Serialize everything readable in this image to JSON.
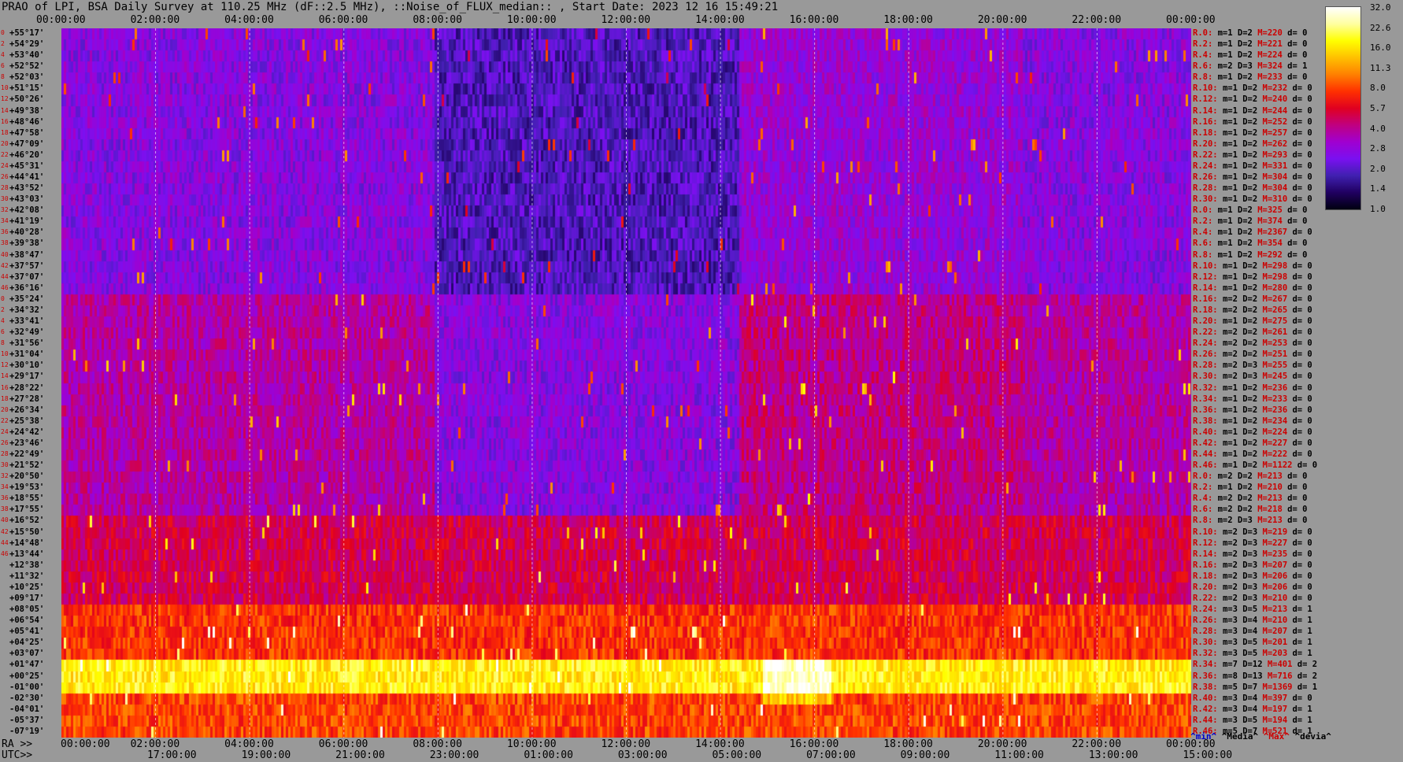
{
  "title": "PRAO of LPI, BSA Daily Survey at 110.25 MHz (dF::2.5 MHz), ::Noise_of_FLUX_median:: , Start Date: 2023 12 16 15:49:21",
  "chart_data": {
    "type": "heatmap",
    "title": "PRAO of LPI, BSA Daily Survey at 110.25 MHz (dF::2.5 MHz), ::Noise_of_FLUX_median:: , Start Date: 2023 12 16 15:49:21",
    "top_ticks": [
      "00:00:00",
      "02:00:00",
      "04:00:00",
      "06:00:00",
      "08:00:00",
      "10:00:00",
      "12:00:00",
      "14:00:00",
      "16:00:00",
      "18:00:00",
      "20:00:00",
      "22:00:00",
      "00:00:00"
    ],
    "ra_prefix": "RA >>",
    "ra_ticks": [
      "00:00:00",
      "02:00:00",
      "04:00:00",
      "06:00:00",
      "08:00:00",
      "10:00:00",
      "12:00:00",
      "14:00:00",
      "16:00:00",
      "18:00:00",
      "20:00:00",
      "22:00:00",
      "00:00:00"
    ],
    "utc_prefix": "UTC>>",
    "utc_ticks": [
      "17:00:00",
      "19:00:00",
      "21:00:00",
      "23:00:00",
      "01:00:00",
      "03:00:00",
      "05:00:00",
      "07:00:00",
      "09:00:00",
      "11:00:00",
      "13:00:00",
      "15:00:00"
    ],
    "row_indices": [
      "0",
      "2",
      "4",
      "6",
      "8",
      "10",
      "12",
      "14",
      "16",
      "18",
      "20",
      "22",
      "24",
      "26",
      "28",
      "30",
      "32",
      "34",
      "36",
      "38",
      "40",
      "42",
      "44",
      "46",
      "0",
      "2",
      "4",
      "6",
      "8",
      "10",
      "12",
      "14",
      "16",
      "18",
      "20",
      "22",
      "24",
      "26",
      "28",
      "30",
      "32",
      "34",
      "36",
      "38",
      "40",
      "42",
      "44",
      "46"
    ],
    "declinations": [
      "+55°17'",
      "+54°29'",
      "+53°40'",
      "+52°52'",
      "+52°03'",
      "+51°15'",
      "+50°26'",
      "+49°38'",
      "+48°46'",
      "+47°58'",
      "+47°09'",
      "+46°20'",
      "+45°31'",
      "+44°41'",
      "+43°52'",
      "+43°03'",
      "+42°08'",
      "+41°19'",
      "+40°28'",
      "+39°38'",
      "+38°47'",
      "+37°57'",
      "+37°07'",
      "+36°16'",
      "+35°24'",
      "+34°32'",
      "+33°41'",
      "+32°49'",
      "+31°56'",
      "+31°04'",
      "+30°10'",
      "+29°17'",
      "+28°22'",
      "+27°28'",
      "+26°34'",
      "+25°38'",
      "+24°42'",
      "+23°46'",
      "+22°49'",
      "+21°52'",
      "+20°50'",
      "+19°53'",
      "+18°55'",
      "+17°55'",
      "+16°52'",
      "+15°50'",
      "+14°48'",
      "+13°44'",
      "+12°38'",
      "+11°32'",
      "+10°25'",
      "+09°17'",
      "+08°05'",
      "+06°54'",
      "+05°41'",
      "+04°25'",
      "+03°07'",
      "+01°47'",
      "+00°25'",
      "-01°00'",
      "-02°30'",
      "-04°01'",
      "-05°37'",
      "-07°19'"
    ],
    "stats": [
      {
        "r": "R.0:",
        "m": "1",
        "D": "2",
        "M": "220",
        "d": "0"
      },
      {
        "r": "R.2:",
        "m": "1",
        "D": "2",
        "M": "221",
        "d": "0"
      },
      {
        "r": "R.4:",
        "m": "1",
        "D": "2",
        "M": "224",
        "d": "0"
      },
      {
        "r": "R.6:",
        "m": "2",
        "D": "3",
        "M": "324",
        "d": "1"
      },
      {
        "r": "R.8:",
        "m": "1",
        "D": "2",
        "M": "233",
        "d": "0"
      },
      {
        "r": "R.10:",
        "m": "1",
        "D": "2",
        "M": "232",
        "d": "0"
      },
      {
        "r": "R.12:",
        "m": "1",
        "D": "2",
        "M": "240",
        "d": "0"
      },
      {
        "r": "R.14:",
        "m": "1",
        "D": "2",
        "M": "244",
        "d": "0"
      },
      {
        "r": "R.16:",
        "m": "1",
        "D": "2",
        "M": "252",
        "d": "0"
      },
      {
        "r": "R.18:",
        "m": "1",
        "D": "2",
        "M": "257",
        "d": "0"
      },
      {
        "r": "R.20:",
        "m": "1",
        "D": "2",
        "M": "262",
        "d": "0"
      },
      {
        "r": "R.22:",
        "m": "1",
        "D": "2",
        "M": "293",
        "d": "0"
      },
      {
        "r": "R.24:",
        "m": "1",
        "D": "2",
        "M": "331",
        "d": "0"
      },
      {
        "r": "R.26:",
        "m": "1",
        "D": "2",
        "M": "304",
        "d": "0"
      },
      {
        "r": "R.28:",
        "m": "1",
        "D": "2",
        "M": "304",
        "d": "0"
      },
      {
        "r": "R.30:",
        "m": "1",
        "D": "2",
        "M": "310",
        "d": "0"
      },
      {
        "r": "R.0:",
        "m": "1",
        "D": "2",
        "M": "325",
        "d": "0"
      },
      {
        "r": "R.2:",
        "m": "1",
        "D": "2",
        "M": "374",
        "d": "0"
      },
      {
        "r": "R.4:",
        "m": "1",
        "D": "2",
        "M": "2367",
        "d": "0"
      },
      {
        "r": "R.6:",
        "m": "1",
        "D": "2",
        "M": "354",
        "d": "0"
      },
      {
        "r": "R.8:",
        "m": "1",
        "D": "2",
        "M": "292",
        "d": "0"
      },
      {
        "r": "R.10:",
        "m": "1",
        "D": "2",
        "M": "298",
        "d": "0"
      },
      {
        "r": "R.12:",
        "m": "1",
        "D": "2",
        "M": "298",
        "d": "0"
      },
      {
        "r": "R.14:",
        "m": "1",
        "D": "2",
        "M": "280",
        "d": "0"
      },
      {
        "r": "R.16:",
        "m": "2",
        "D": "2",
        "M": "267",
        "d": "0"
      },
      {
        "r": "R.18:",
        "m": "2",
        "D": "2",
        "M": "265",
        "d": "0"
      },
      {
        "r": "R.20:",
        "m": "1",
        "D": "2",
        "M": "275",
        "d": "0"
      },
      {
        "r": "R.22:",
        "m": "2",
        "D": "2",
        "M": "261",
        "d": "0"
      },
      {
        "r": "R.24:",
        "m": "2",
        "D": "2",
        "M": "253",
        "d": "0"
      },
      {
        "r": "R.26:",
        "m": "2",
        "D": "2",
        "M": "251",
        "d": "0"
      },
      {
        "r": "R.28:",
        "m": "2",
        "D": "3",
        "M": "255",
        "d": "0"
      },
      {
        "r": "R.30:",
        "m": "2",
        "D": "3",
        "M": "245",
        "d": "0"
      },
      {
        "r": "R.32:",
        "m": "1",
        "D": "2",
        "M": "236",
        "d": "0"
      },
      {
        "r": "R.34:",
        "m": "1",
        "D": "2",
        "M": "233",
        "d": "0"
      },
      {
        "r": "R.36:",
        "m": "1",
        "D": "2",
        "M": "236",
        "d": "0"
      },
      {
        "r": "R.38:",
        "m": "1",
        "D": "2",
        "M": "234",
        "d": "0"
      },
      {
        "r": "R.40:",
        "m": "1",
        "D": "2",
        "M": "224",
        "d": "0"
      },
      {
        "r": "R.42:",
        "m": "1",
        "D": "2",
        "M": "227",
        "d": "0"
      },
      {
        "r": "R.44:",
        "m": "1",
        "D": "2",
        "M": "222",
        "d": "0"
      },
      {
        "r": "R.46:",
        "m": "1",
        "D": "2",
        "M": "1122",
        "d": "0"
      },
      {
        "r": "R.0:",
        "m": "2",
        "D": "2",
        "M": "213",
        "d": "0"
      },
      {
        "r": "R.2:",
        "m": "1",
        "D": "2",
        "M": "210",
        "d": "0"
      },
      {
        "r": "R.4:",
        "m": "2",
        "D": "2",
        "M": "213",
        "d": "0"
      },
      {
        "r": "R.6:",
        "m": "2",
        "D": "2",
        "M": "218",
        "d": "0"
      },
      {
        "r": "R.8:",
        "m": "2",
        "D": "3",
        "M": "213",
        "d": "0"
      },
      {
        "r": "R.10:",
        "m": "2",
        "D": "3",
        "M": "219",
        "d": "0"
      },
      {
        "r": "R.12:",
        "m": "2",
        "D": "3",
        "M": "227",
        "d": "0"
      },
      {
        "r": "R.14:",
        "m": "2",
        "D": "3",
        "M": "235",
        "d": "0"
      },
      {
        "r": "R.16:",
        "m": "2",
        "D": "3",
        "M": "207",
        "d": "0"
      },
      {
        "r": "R.18:",
        "m": "2",
        "D": "3",
        "M": "206",
        "d": "0"
      },
      {
        "r": "R.20:",
        "m": "2",
        "D": "3",
        "M": "206",
        "d": "0"
      },
      {
        "r": "R.22:",
        "m": "2",
        "D": "3",
        "M": "210",
        "d": "0"
      },
      {
        "r": "R.24:",
        "m": "3",
        "D": "5",
        "M": "213",
        "d": "1"
      },
      {
        "r": "R.26:",
        "m": "3",
        "D": "4",
        "M": "210",
        "d": "1"
      },
      {
        "r": "R.28:",
        "m": "3",
        "D": "4",
        "M": "207",
        "d": "1"
      },
      {
        "r": "R.30:",
        "m": "3",
        "D": "5",
        "M": "201",
        "d": "1"
      },
      {
        "r": "R.32:",
        "m": "3",
        "D": "5",
        "M": "203",
        "d": "1"
      },
      {
        "r": "R.34:",
        "m": "7",
        "D": "12",
        "M": "401",
        "d": "2"
      },
      {
        "r": "R.36:",
        "m": "8",
        "D": "13",
        "M": "716",
        "d": "2"
      },
      {
        "r": "R.38:",
        "m": "5",
        "D": "7",
        "M": "1369",
        "d": "1"
      },
      {
        "r": "R.40:",
        "m": "3",
        "D": "4",
        "M": "397",
        "d": "0"
      },
      {
        "r": "R.42:",
        "m": "3",
        "D": "4",
        "M": "197",
        "d": "1"
      },
      {
        "r": "R.44:",
        "m": "3",
        "D": "5",
        "M": "194",
        "d": "1"
      },
      {
        "r": "R.46:",
        "m": "5",
        "D": "7",
        "M": "521",
        "d": "1"
      }
    ],
    "colorbar": {
      "scale": "log",
      "ticks": [
        "32.0",
        "22.6",
        "16.0",
        "11.3",
        "8.0",
        "5.7",
        "4.0",
        "2.8",
        "2.0",
        "1.4",
        "1.0"
      ],
      "colormap": [
        "#ffffff",
        "#ffffa0",
        "#ffff00",
        "#ffc000",
        "#ff8000",
        "#ff3000",
        "#e00020",
        "#c00080",
        "#a000d0",
        "#7a10f0",
        "#4020b0",
        "#200060",
        "#000010"
      ]
    },
    "legend": [
      "^min^",
      "^Media^",
      "^Max^",
      "^devia^"
    ]
  }
}
